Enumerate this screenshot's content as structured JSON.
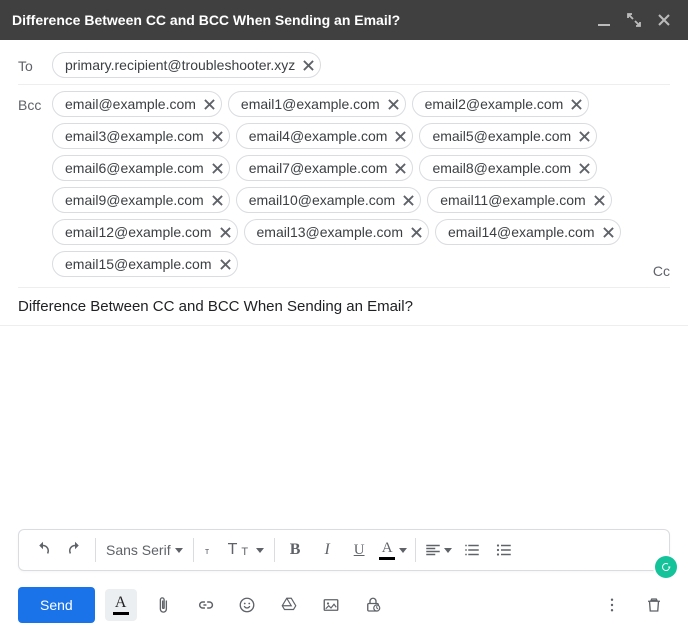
{
  "header": {
    "title": "Difference Between CC and BCC When Sending an Email?"
  },
  "to": {
    "label": "To",
    "chips": [
      "primary.recipient@troubleshooter.xyz"
    ]
  },
  "bcc": {
    "label": "Bcc",
    "chips": [
      "email@example.com",
      "email1@example.com",
      "email2@example.com",
      "email3@example.com",
      "email4@example.com",
      "email5@example.com",
      "email6@example.com",
      "email7@example.com",
      "email8@example.com",
      "email9@example.com",
      "email10@example.com",
      "email11@example.com",
      "email12@example.com",
      "email13@example.com",
      "email14@example.com",
      "email15@example.com"
    ],
    "cc_link": "Cc"
  },
  "subject": "Difference Between CC and BCC When Sending an Email?",
  "toolbar": {
    "font": "Sans Serif",
    "b": "B",
    "i": "I",
    "u": "U",
    "a": "A"
  },
  "actions": {
    "send": "Send"
  }
}
